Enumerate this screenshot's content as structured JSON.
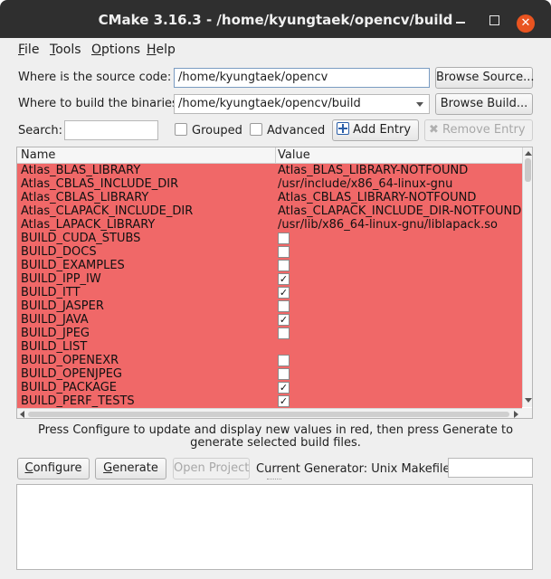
{
  "window": {
    "title": "CMake 3.16.3 - /home/kyungtaek/opencv/build"
  },
  "menu": [
    {
      "label": "File",
      "underline": "F",
      "rest": "ile"
    },
    {
      "label": "Tools",
      "underline": "T",
      "rest": "ools"
    },
    {
      "label": "Options",
      "underline": "O",
      "rest": "ptions"
    },
    {
      "label": "Help",
      "underline": "H",
      "rest": "elp"
    }
  ],
  "source": {
    "label": "Where is the source code:",
    "value": "/home/kyungtaek/opencv",
    "browse_label": "Browse Source..."
  },
  "build": {
    "label": "Where to build the binaries:",
    "value": "/home/kyungtaek/opencv/build",
    "browse_label": "Browse Build..."
  },
  "search": {
    "label": "Search:",
    "value": "",
    "grouped_label": "Grouped",
    "advanced_label": "Advanced",
    "add_entry_label": "Add Entry",
    "remove_entry_label": "Remove Entry"
  },
  "table": {
    "columns": [
      "Name",
      "Value"
    ],
    "rows": [
      {
        "name": "Atlas_BLAS_LIBRARY",
        "value": "Atlas_BLAS_LIBRARY-NOTFOUND"
      },
      {
        "name": "Atlas_CBLAS_INCLUDE_DIR",
        "value": "/usr/include/x86_64-linux-gnu"
      },
      {
        "name": "Atlas_CBLAS_LIBRARY",
        "value": "Atlas_CBLAS_LIBRARY-NOTFOUND"
      },
      {
        "name": "Atlas_CLAPACK_INCLUDE_DIR",
        "value": "Atlas_CLAPACK_INCLUDE_DIR-NOTFOUND"
      },
      {
        "name": "Atlas_LAPACK_LIBRARY",
        "value": "/usr/lib/x86_64-linux-gnu/liblapack.so"
      },
      {
        "name": "BUILD_CUDA_STUBS",
        "checkbox": true,
        "checked": false
      },
      {
        "name": "BUILD_DOCS",
        "checkbox": true,
        "checked": false
      },
      {
        "name": "BUILD_EXAMPLES",
        "checkbox": true,
        "checked": false
      },
      {
        "name": "BUILD_IPP_IW",
        "checkbox": true,
        "checked": true
      },
      {
        "name": "BUILD_ITT",
        "checkbox": true,
        "checked": true
      },
      {
        "name": "BUILD_JASPER",
        "checkbox": true,
        "checked": false
      },
      {
        "name": "BUILD_JAVA",
        "checkbox": true,
        "checked": true
      },
      {
        "name": "BUILD_JPEG",
        "checkbox": true,
        "checked": false
      },
      {
        "name": "BUILD_LIST",
        "value": ""
      },
      {
        "name": "BUILD_OPENEXR",
        "checkbox": true,
        "checked": false
      },
      {
        "name": "BUILD_OPENJPEG",
        "checkbox": true,
        "checked": false
      },
      {
        "name": "BUILD_PACKAGE",
        "checkbox": true,
        "checked": true
      },
      {
        "name": "BUILD_PERF_TESTS",
        "checkbox": true,
        "checked": true
      }
    ],
    "row_color": "#f06868"
  },
  "info_text": "Press Configure to update and display new values in red, then press Generate to generate selected build files.",
  "actions": {
    "configure_label": "Configure",
    "generate_label": "Generate",
    "open_project_label": "Open Project",
    "generator_text": "Current Generator: Unix Makefiles"
  },
  "colors": {
    "titlebar": "#2f2f2f",
    "close_button": "#e95420",
    "changed_row": "#f06868"
  }
}
